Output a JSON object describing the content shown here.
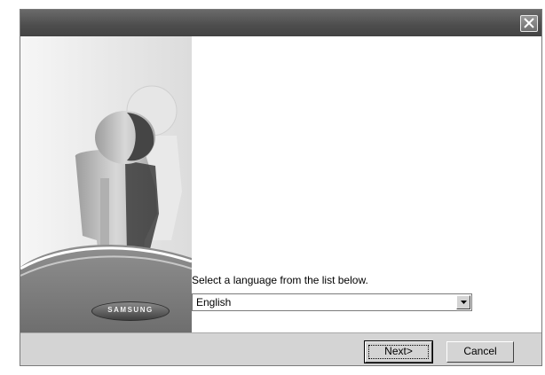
{
  "window": {
    "close_icon": "close-icon"
  },
  "side_panel": {
    "brand_logo": "SAMSUNG",
    "colors": {
      "accent_green": "#8a8a8a",
      "accent_dark": "#3f3f3f"
    }
  },
  "language": {
    "prompt": "Select a language from the list below.",
    "selected": "English",
    "dropdown_icon": "chevron-down-icon"
  },
  "buttons": {
    "next_label": "Next>",
    "cancel_label": "Cancel"
  }
}
